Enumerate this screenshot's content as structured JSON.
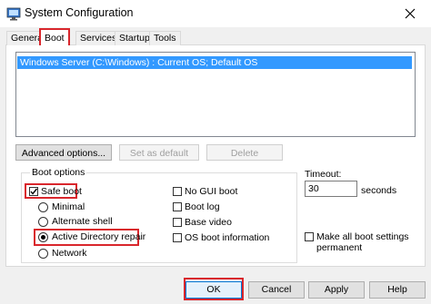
{
  "window": {
    "title": "System Configuration",
    "close_icon": "close-icon",
    "app_icon": "system-configuration-icon"
  },
  "tabs": [
    {
      "label": "General"
    },
    {
      "label": "Boot"
    },
    {
      "label": "Services"
    },
    {
      "label": "Startup"
    },
    {
      "label": "Tools"
    }
  ],
  "os_list": {
    "items": [
      "Windows Server (C:\\Windows) : Current OS; Default OS"
    ]
  },
  "buttons": {
    "advanced": "Advanced options...",
    "set_default": "Set as default",
    "delete": "Delete"
  },
  "boot_options": {
    "label": "Boot options",
    "safe_boot": {
      "label": "Safe boot",
      "checked": true
    },
    "minimal": "Minimal",
    "alternate_shell": "Alternate shell",
    "active_directory_repair": "Active Directory repair",
    "network": "Network",
    "no_gui_boot": "No GUI boot",
    "boot_log": "Boot log",
    "base_video": "Base video",
    "os_boot_information": "OS boot information"
  },
  "timeout": {
    "label": "Timeout:",
    "value": "30",
    "units": "seconds"
  },
  "make_permanent": {
    "line1": "Make all boot settings",
    "line2": "permanent"
  },
  "footer": {
    "ok": "OK",
    "cancel": "Cancel",
    "apply": "Apply",
    "help": "Help"
  },
  "colors": {
    "highlight_red": "#d9262c",
    "selection_blue": "#3399ff"
  }
}
